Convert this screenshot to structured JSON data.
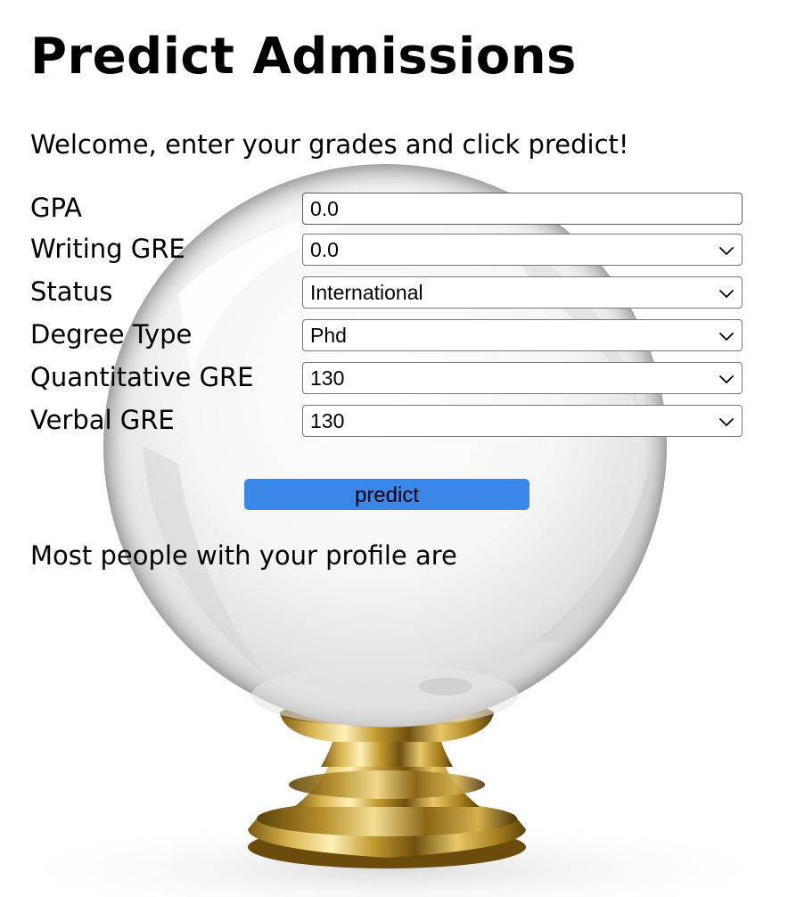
{
  "page": {
    "title": "Predict Admissions",
    "welcome": "Welcome, enter your grades and click predict!"
  },
  "form": {
    "fields": [
      {
        "label": "GPA",
        "type": "text",
        "value": "0.0"
      },
      {
        "label": "Writing GRE",
        "type": "select",
        "value": "0.0"
      },
      {
        "label": "Status",
        "type": "select",
        "value": "International"
      },
      {
        "label": "Degree Type",
        "type": "select",
        "value": "Phd"
      },
      {
        "label": "Quantitative GRE",
        "type": "select",
        "value": "130"
      },
      {
        "label": "Verbal GRE",
        "type": "select",
        "value": "130"
      }
    ],
    "submit_label": "predict"
  },
  "result": {
    "text": "Most people with your profile are"
  },
  "icons": {
    "select_arrow": "chevron-down-icon",
    "background": "crystal-ball-illustration"
  },
  "colors": {
    "button": "#3b87e8",
    "text": "#000000",
    "background": "#ffffff"
  }
}
